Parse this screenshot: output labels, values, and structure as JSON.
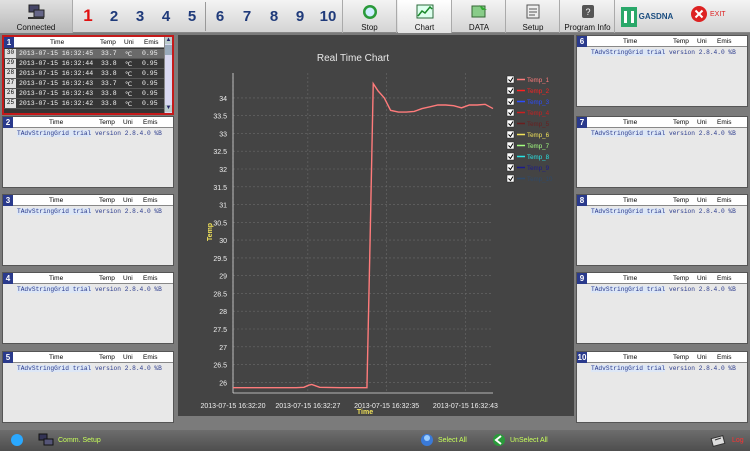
{
  "toolbar": {
    "connected": "Connected",
    "tabs": [
      "1",
      "2",
      "3",
      "4",
      "5",
      "6",
      "7",
      "8",
      "9",
      "10"
    ],
    "stop": "Stop",
    "chart": "Chart",
    "data": "DATA",
    "setup": "Setup",
    "program_info": "Program Info",
    "logo": "GASDNA",
    "exit": "EXIT"
  },
  "columns": {
    "time": "Time",
    "temp": "Temp",
    "unit": "Uni",
    "emis": "Emis"
  },
  "panel1": {
    "number": "1",
    "rows": [
      {
        "idx": "30",
        "time": "2013-07-15 16:32:45",
        "temp": "33.7",
        "unit": "℃",
        "emis": "0.95"
      },
      {
        "idx": "29",
        "time": "2013-07-15 16:32:44",
        "temp": "33.8",
        "unit": "℃",
        "emis": "0.95"
      },
      {
        "idx": "28",
        "time": "2013-07-15 16:32:44",
        "temp": "33.8",
        "unit": "℃",
        "emis": "0.95"
      },
      {
        "idx": "27",
        "time": "2013-07-15 16:32:43",
        "temp": "33.7",
        "unit": "℃",
        "emis": "0.95"
      },
      {
        "idx": "26",
        "time": "2013-07-15 16:32:43",
        "temp": "33.8",
        "unit": "℃",
        "emis": "0.95"
      },
      {
        "idx": "25",
        "time": "2013-07-15 16:32:42",
        "temp": "33.8",
        "unit": "℃",
        "emis": "0.95"
      }
    ]
  },
  "trial_text": {
    "a": "TAdvStringGrid trial",
    "b": "version 2.8.4.0 %B"
  },
  "panels": [
    {
      "number": "2"
    },
    {
      "number": "3"
    },
    {
      "number": "4"
    },
    {
      "number": "5"
    },
    {
      "number": "6"
    },
    {
      "number": "7"
    },
    {
      "number": "8"
    },
    {
      "number": "9"
    },
    {
      "number": "10"
    }
  ],
  "chart_data": {
    "type": "line",
    "title": "Real Time Chart",
    "xlabel": "Time",
    "ylabel": "Temp",
    "ylim": [
      25.7,
      34.7
    ],
    "yticks": [
      "34",
      "33.5",
      "33",
      "32.5",
      "32",
      "31.5",
      "31",
      "30.5",
      "30",
      "29.5",
      "29",
      "28.5",
      "28",
      "27.5",
      "27",
      "26.5",
      "26"
    ],
    "xticks": [
      "2013-07-15 16:32:20",
      "2013-07-15 16:32:27",
      "2013-07-15 16:32:35",
      "2013-07-15 16:32:43"
    ],
    "grid": true,
    "legend_position": "right",
    "series": [
      {
        "name": "Temp_1",
        "color": "#ff7b7b",
        "x": [
          0,
          8,
          9,
          9.6,
          10,
          11,
          13.7,
          16,
          17,
          17.4,
          17.8,
          18.4,
          19.2,
          20,
          21,
          22,
          23,
          24,
          25,
          26,
          27,
          28,
          29,
          30,
          31,
          32,
          33
        ],
        "y": [
          25.85,
          25.85,
          25.86,
          25.92,
          25.94,
          25.86,
          25.85,
          25.85,
          25.85,
          30.0,
          34.4,
          34.2,
          34.0,
          33.65,
          33.6,
          33.6,
          33.62,
          33.7,
          33.75,
          33.8,
          33.8,
          33.78,
          33.72,
          33.8,
          33.8,
          33.82,
          33.7
        ]
      },
      {
        "name": "Temp_2",
        "color": "#ff2020"
      },
      {
        "name": "Temp_3",
        "color": "#2a4cff"
      },
      {
        "name": "Temp_4",
        "color": "#cc1f1f"
      },
      {
        "name": "Temp_5",
        "color": "#6b1e1e"
      },
      {
        "name": "Temp_6",
        "color": "#f2e35a"
      },
      {
        "name": "Temp_7",
        "color": "#a3ff80"
      },
      {
        "name": "Temp_8",
        "color": "#28e5e5"
      },
      {
        "name": "Temp_9",
        "color": "#1b1b8c"
      },
      {
        "name": "Temp_10",
        "color": "#2f4a6a"
      }
    ]
  },
  "status": {
    "comm_setup": "Comm. Setup",
    "select_all": "Select All",
    "unselect_all": "UnSelect All",
    "log": "Log"
  }
}
